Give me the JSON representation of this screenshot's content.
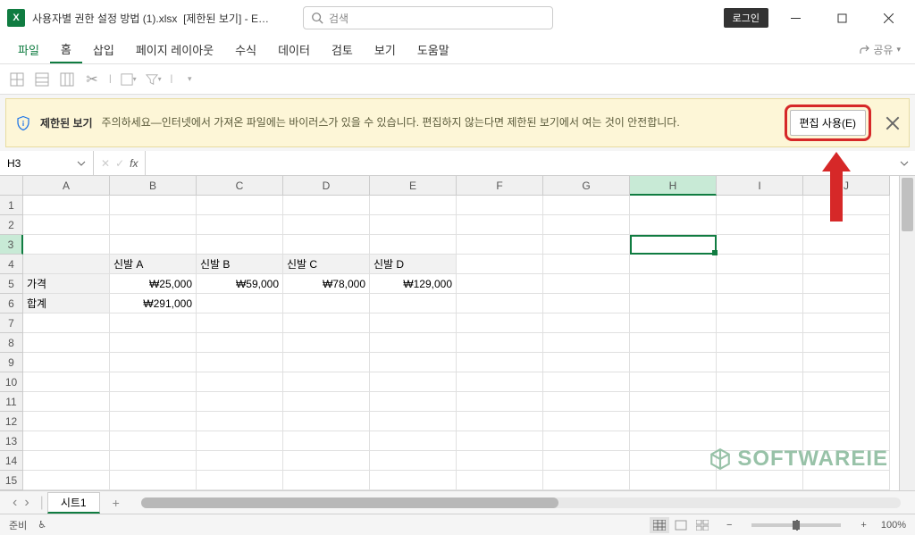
{
  "titlebar": {
    "filename": "사용자별 권한 설정 방법 (1).xlsx",
    "mode": "[제한된 보기]",
    "app_suffix": " - E…",
    "search_placeholder": "검색",
    "login_label": "로그인"
  },
  "ribbon": {
    "tabs": [
      "파일",
      "홈",
      "삽입",
      "페이지 레이아웃",
      "수식",
      "데이터",
      "검토",
      "보기",
      "도움말"
    ],
    "share_label": "공유"
  },
  "protected_view": {
    "label": "제한된 보기",
    "message": "주의하세요—인터넷에서 가져온 파일에는 바이러스가 있을 수 있습니다. 편집하지 않는다면 제한된 보기에서 여는 것이 안전합니다.",
    "button": "편집 사용(E)"
  },
  "namebox": {
    "ref": "H3"
  },
  "grid": {
    "columns": [
      "A",
      "B",
      "C",
      "D",
      "E",
      "F",
      "G",
      "H",
      "I",
      "J"
    ],
    "rows": [
      "1",
      "2",
      "3",
      "4",
      "5",
      "6",
      "7",
      "8",
      "9",
      "10",
      "11",
      "12",
      "13",
      "14",
      "15"
    ],
    "selected_col": "H",
    "selected_row": "3",
    "data": {
      "r4": {
        "B": "신발 A",
        "C": "신발 B",
        "D": "신발 C",
        "E": "신발 D"
      },
      "r5": {
        "A": "가격",
        "B": "₩25,000",
        "C": "₩59,000",
        "D": "₩78,000",
        "E": "₩129,000"
      },
      "r6": {
        "A": "합계",
        "B": "₩291,000"
      }
    }
  },
  "chart_data": {
    "type": "table",
    "categories": [
      "신발 A",
      "신발 B",
      "신발 C",
      "신발 D"
    ],
    "series": [
      {
        "name": "가격",
        "values": [
          25000,
          59000,
          78000,
          129000
        ]
      },
      {
        "name": "합계",
        "values": [
          291000,
          null,
          null,
          null
        ]
      }
    ],
    "currency": "KRW"
  },
  "sheet": {
    "tabs": [
      "시트1"
    ]
  },
  "status": {
    "ready": "준비",
    "zoom": "100%",
    "zoom_plus": "+",
    "zoom_minus": "−"
  },
  "watermark": "SOFTWAREIE"
}
